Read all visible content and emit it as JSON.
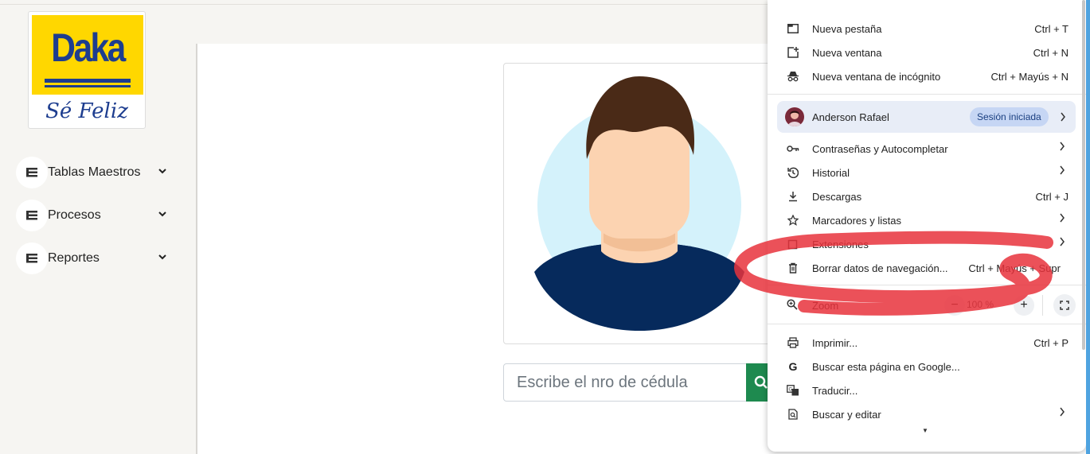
{
  "logo": {
    "brand": "Daka",
    "slogan": "Sé Feliz"
  },
  "sidebar": {
    "items": [
      {
        "label": "Tablas Maestros",
        "icon": "list-icon"
      },
      {
        "label": "Procesos",
        "icon": "list-icon"
      },
      {
        "label": "Reportes",
        "icon": "list-icon"
      }
    ]
  },
  "search": {
    "placeholder": "Escribe el nro de cédula",
    "button_icon": "search-icon"
  },
  "chrome_menu": {
    "items": {
      "new_tab": {
        "label": "Nueva pestaña",
        "shortcut": "Ctrl + T"
      },
      "new_window": {
        "label": "Nueva ventana",
        "shortcut": "Ctrl + N"
      },
      "incognito": {
        "label": "Nueva ventana de incógnito",
        "shortcut": "Ctrl + Mayús + N"
      },
      "passwords": {
        "label": "Contraseñas y Autocompletar"
      },
      "history": {
        "label": "Historial"
      },
      "downloads": {
        "label": "Descargas",
        "shortcut": "Ctrl + J"
      },
      "bookmarks": {
        "label": "Marcadores y listas"
      },
      "extensions": {
        "label": "Extensiones"
      },
      "clear_data": {
        "label": "Borrar datos de navegación...",
        "shortcut": "Ctrl + Mayús + Supr"
      },
      "print": {
        "label": "Imprimir...",
        "shortcut": "Ctrl + P"
      },
      "google_search": {
        "label": "Buscar esta página en Google..."
      },
      "translate": {
        "label": "Traducir..."
      },
      "find_edit": {
        "label": "Buscar y editar"
      }
    },
    "profile": {
      "name": "Anderson Rafael",
      "badge": "Sesión iniciada"
    },
    "zoom": {
      "label": "Zoom",
      "minus": "−",
      "value": "100 %",
      "plus": "+"
    }
  },
  "colors": {
    "brand_yellow": "#ffd700",
    "brand_blue": "#1d3d8f",
    "search_button": "#1e8a4f",
    "annotation_red": "#e8323c"
  }
}
